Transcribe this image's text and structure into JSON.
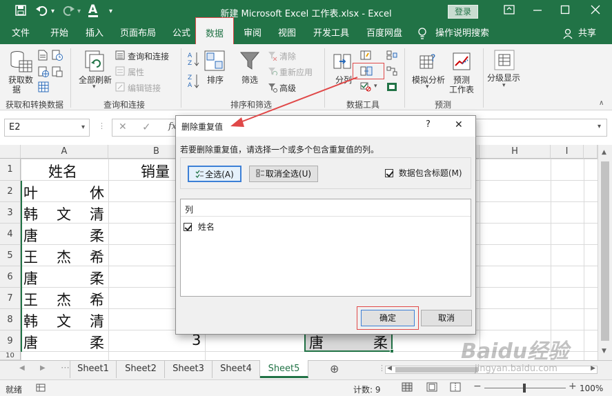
{
  "titlebar": {
    "title": "新建 Microsoft Excel 工作表.xlsx - Excel",
    "login": "登录",
    "font_color_glyph": "A"
  },
  "menu": {
    "items": [
      "文件",
      "开始",
      "插入",
      "页面布局",
      "公式",
      "数据",
      "审阅",
      "视图",
      "开发工具",
      "百度网盘"
    ],
    "tellme": "操作说明搜索",
    "share": "共享"
  },
  "ribbon": {
    "get_data_line1": "获取数",
    "get_data_line2": "据",
    "group_get": "获取和转换数据",
    "refresh_all": "全部刷新",
    "queries_connections": "查询和连接",
    "properties": "属性",
    "edit_links": "编辑链接",
    "group_queries": "查询和连接",
    "sort": "排序",
    "filter": "筛选",
    "clear": "清除",
    "reapply": "重新应用",
    "advanced": "高级",
    "group_sort": "排序和筛选",
    "split": "分列",
    "group_tools": "数据工具",
    "whatif": "模拟分析",
    "forecast_line1": "预测",
    "forecast_line2": "工作表",
    "group_forecast": "预测",
    "outline": "分级显示",
    "sort_az_top": "A",
    "sort_az_bottom": "Z",
    "sort_za_top": "Z",
    "sort_za_bottom": "A"
  },
  "formula_bar": {
    "name_box": "E2",
    "fx": "fx"
  },
  "grid": {
    "columns": [
      "A",
      "B",
      "H",
      "I"
    ],
    "rows": [
      "1",
      "2",
      "3",
      "4",
      "5",
      "6",
      "7",
      "8",
      "9",
      "10"
    ],
    "header_a": "姓名",
    "header_b": "销量",
    "names": [
      [
        "叶",
        "",
        "休"
      ],
      [
        "韩",
        "文",
        "清"
      ],
      [
        "唐",
        "",
        "柔"
      ],
      [
        "王",
        "杰",
        "希"
      ],
      [
        "唐",
        "",
        "柔"
      ],
      [
        "王",
        "杰",
        "希"
      ],
      [
        "韩",
        "文",
        "清"
      ],
      [
        "唐",
        "",
        "柔"
      ]
    ],
    "b9_value": "3",
    "e9_left": "唐",
    "e9_right": "柔"
  },
  "dialog": {
    "title": "删除重复值",
    "help": "?",
    "close": "✕",
    "instruction": "若要删除重复值，请选择一个或多个包含重复值的列。",
    "select_all": "全选(A)",
    "unselect_all": "取消全选(U)",
    "has_headers": "数据包含标题(M)",
    "list_header": "列",
    "column_item": "姓名",
    "ok": "确定",
    "cancel": "取消"
  },
  "sheets": [
    "Sheet1",
    "Sheet2",
    "Sheet3",
    "Sheet4",
    "Sheet5"
  ],
  "status": {
    "ready": "就绪",
    "count": "计数: 9",
    "zoom": "100%"
  },
  "watermark": {
    "line1": "Baidu经验",
    "line2": "jingyan.baidu.com"
  },
  "colors": {
    "excel_green": "#217346",
    "highlight_red": "#e04848"
  }
}
